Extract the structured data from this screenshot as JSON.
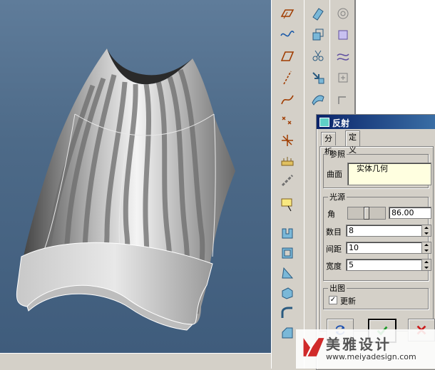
{
  "dialog": {
    "title": "反射",
    "tabs": [
      {
        "label": "分析"
      },
      {
        "label": "定义"
      }
    ],
    "reference": {
      "group_label": "参照",
      "surface_label": "曲面",
      "surface_value": "实体几何"
    },
    "light": {
      "group_label": "光源",
      "angle_label": "角",
      "angle_value": "86.00",
      "angle_slider_fraction": 0.5,
      "count_label": "数目",
      "count_value": "8",
      "spacing_label": "间距",
      "spacing_value": "10",
      "width_label": "宽度",
      "width_value": "5"
    },
    "output": {
      "group_label": "出图",
      "update_label": "更新",
      "update_checked": true
    }
  },
  "watermark": {
    "brand": "美雅设计",
    "url": "www.meiyadesign.com"
  },
  "colors": {
    "viewport_bg": "#4d6a88",
    "titlebar": "#0a246a",
    "ok_green": "#1e9a2a",
    "cancel_red": "#cc1c1c"
  }
}
